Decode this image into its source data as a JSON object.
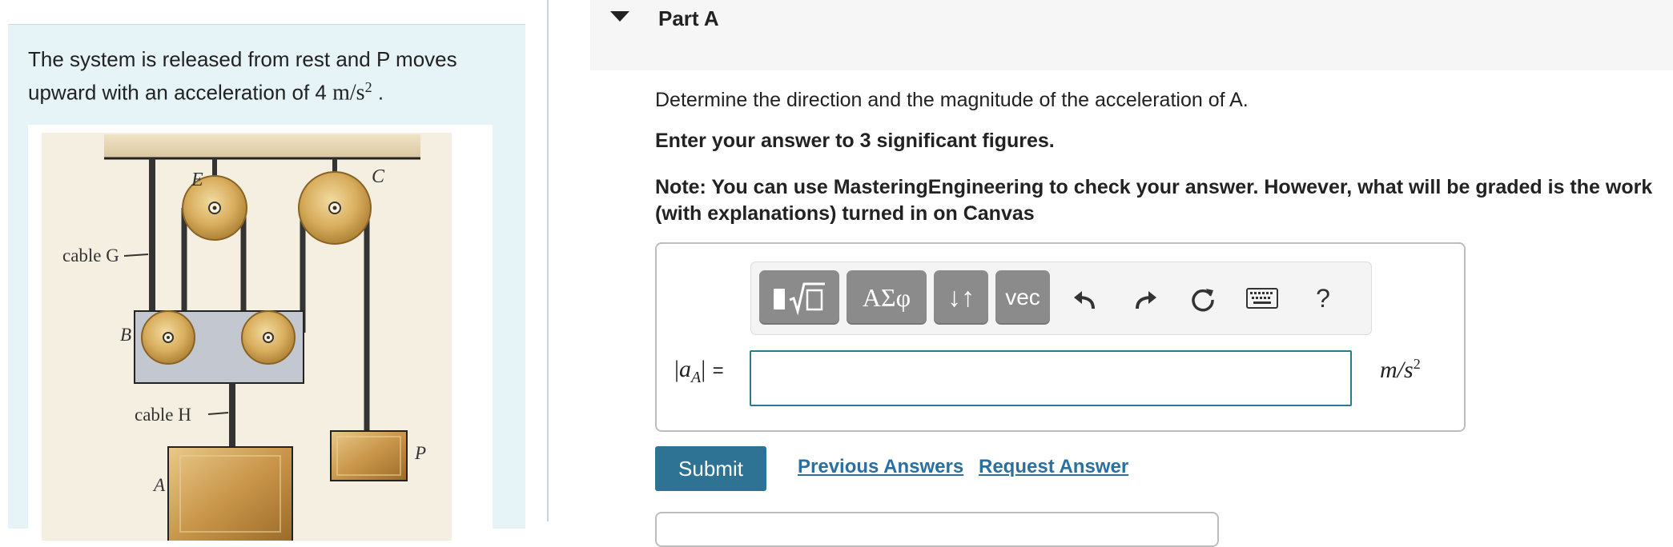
{
  "problem": {
    "text_before": "The system is released from rest and P moves upward with an acceleration of 4 ",
    "math": "m/s",
    "exponent": "2",
    "text_after": " ."
  },
  "figure": {
    "labels": {
      "E": "E",
      "C": "C",
      "cable_g": "cable G",
      "B": "B",
      "cable_h": "cable H",
      "P": "P",
      "A": "A"
    }
  },
  "part": {
    "title": "Part A"
  },
  "question": {
    "text": "Determine the direction and the magnitude of the acceleration of A.",
    "sig_figs": "Enter your answer to 3 significant figures.",
    "note": "Note: You can use MasteringEngineering to check your answer. However, what will be graded is the work (with explanations) turned in on Canvas"
  },
  "toolbar": {
    "greek_label": "ΑΣφ",
    "arrows_label": "↓↑",
    "vec_label": "vec",
    "help_label": "?"
  },
  "answer": {
    "label_var": "a",
    "label_sub": "A",
    "equals": "=",
    "value": "",
    "unit_base": "m/s",
    "unit_exp": "2"
  },
  "actions": {
    "submit_label": "Submit",
    "previous_answers_label": "Previous Answers",
    "request_answer_label": "Request Answer"
  }
}
